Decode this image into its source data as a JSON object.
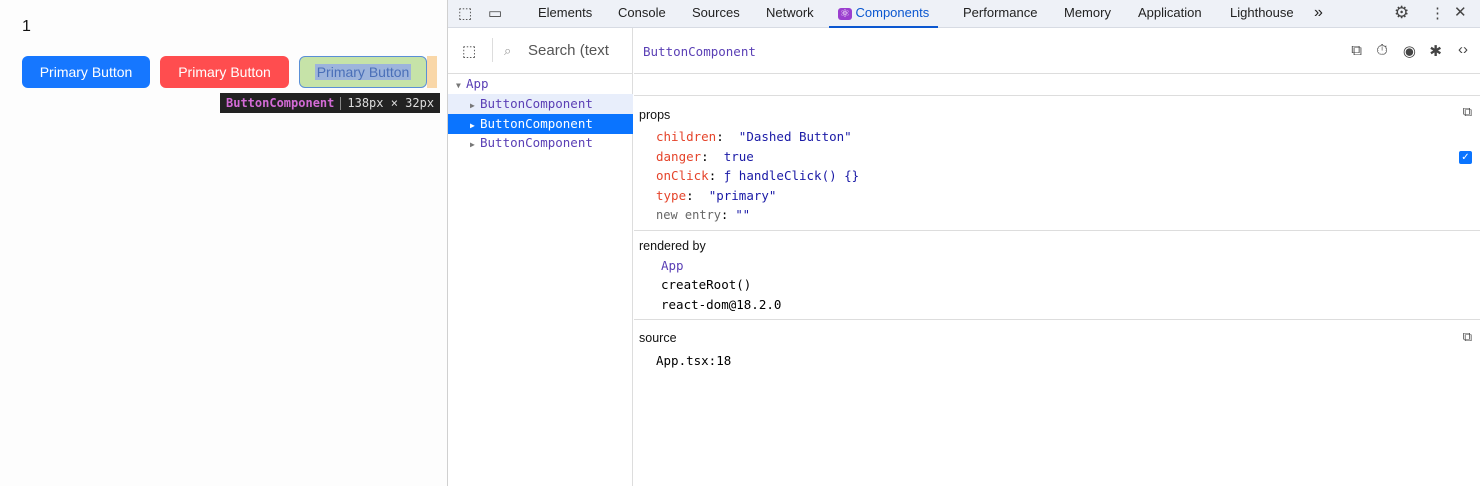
{
  "page": {
    "counter": "1",
    "buttons": [
      "Primary Button",
      "Primary Button",
      "Primary Button"
    ],
    "tooltip": {
      "name": "ButtonComponent",
      "size": "138px × 32px"
    }
  },
  "devtools": {
    "tabs": [
      "Elements",
      "Console",
      "Sources",
      "Network",
      "Components",
      "Performance",
      "Memory",
      "Application",
      "Lighthouse"
    ],
    "active_tab": "Components",
    "more": "»",
    "search_placeholder": "Search (text",
    "tree": [
      {
        "label": "App"
      },
      {
        "label": "ButtonComponent"
      },
      {
        "label": "ButtonComponent"
      },
      {
        "label": "ButtonComponent"
      }
    ],
    "selected_component": "ButtonComponent",
    "props": {
      "title": "props",
      "items": [
        {
          "key": "children",
          "value": "\"Dashed Button\""
        },
        {
          "key": "danger",
          "value": "true"
        },
        {
          "key": "onClick",
          "value": "ƒ handleClick() {}"
        },
        {
          "key": "type",
          "value": "\"primary\""
        },
        {
          "key": "new entry",
          "value": "\"\""
        }
      ]
    },
    "rendered_by": {
      "title": "rendered by",
      "items": [
        "App",
        "createRoot()",
        "react-dom@18.2.0"
      ]
    },
    "source": {
      "title": "source",
      "value": "App.tsx:18"
    }
  },
  "colors": {
    "accent": "#0b57d0",
    "selection": "#0a74ff"
  }
}
